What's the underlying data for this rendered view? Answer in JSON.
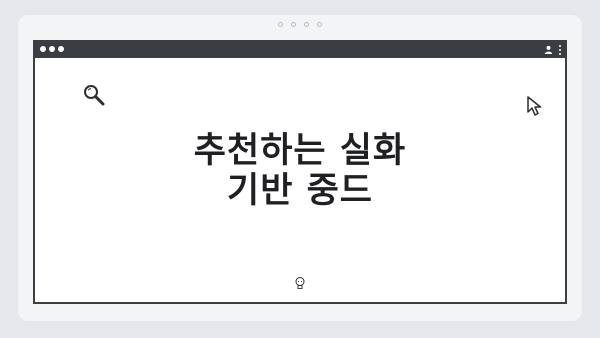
{
  "headline": {
    "line1": "추천하는 실화",
    "line2": "기반 중드"
  },
  "icons": {
    "search": "search-icon",
    "cursor": "cursor-pointer-icon",
    "bulb": "lightbulb-icon",
    "user": "user-icon",
    "menu": "kebab-menu-icon"
  },
  "colors": {
    "frame": "#3a3d42",
    "page_background": "#e5e7eb",
    "window_background": "#ffffff",
    "text": "#1f2023"
  }
}
